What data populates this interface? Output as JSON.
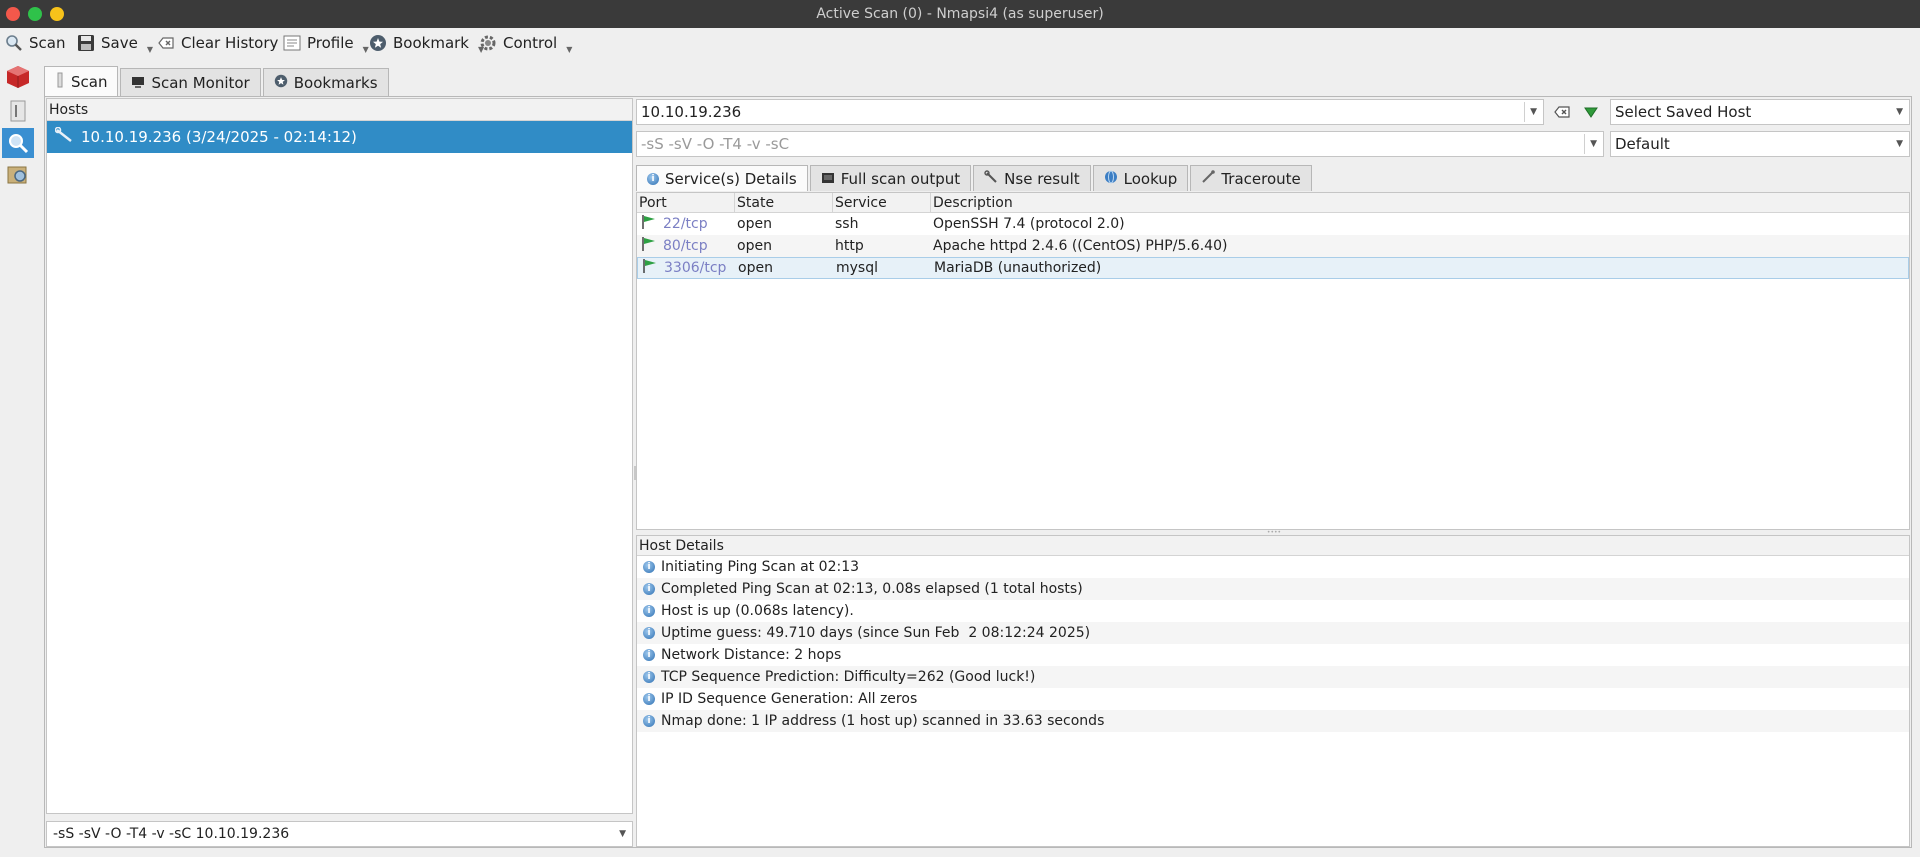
{
  "window": {
    "title": "Active Scan (0) - Nmapsi4 (as superuser)"
  },
  "toolbar": {
    "scan": "Scan",
    "save": "Save",
    "clear_history": "Clear History",
    "profile": "Profile",
    "bookmark": "Bookmark",
    "control": "Control"
  },
  "main_tabs": [
    "Scan",
    "Scan Monitor",
    "Bookmarks"
  ],
  "hosts": {
    "header": "Hosts",
    "items": [
      "10.10.19.236 (3/24/2025 - 02:14:12)"
    ],
    "command": "-sS -sV -O -T4 -v -sC 10.10.19.236"
  },
  "target": {
    "value": "10.10.19.236",
    "saved_host": "Select Saved Host",
    "options": "-sS -sV -O -T4 -v -sC",
    "profile": "Default"
  },
  "result_tabs": [
    "Service(s) Details",
    "Full scan output",
    "Nse result",
    "Lookup",
    "Traceroute"
  ],
  "ports": {
    "columns": [
      "Port",
      "State",
      "Service",
      "Description"
    ],
    "rows": [
      {
        "port": "22/tcp",
        "state": "open",
        "service": "ssh",
        "description": "OpenSSH 7.4 (protocol 2.0)"
      },
      {
        "port": "80/tcp",
        "state": "open",
        "service": "http",
        "description": "Apache httpd 2.4.6 ((CentOS) PHP/5.6.40)"
      },
      {
        "port": "3306/tcp",
        "state": "open",
        "service": "mysql",
        "description": "MariaDB (unauthorized)"
      }
    ]
  },
  "host_details": {
    "header": "Host Details",
    "lines": [
      "Initiating Ping Scan at 02:13",
      "Completed Ping Scan at 02:13, 0.08s elapsed (1 total hosts)",
      "Host is up (0.068s latency).",
      "Uptime guess: 49.710 days (since Sun Feb  2 08:12:24 2025)",
      "Network Distance: 2 hops",
      "TCP Sequence Prediction: Difficulty=262 (Good luck!)",
      "IP ID Sequence Generation: All zeros",
      "Nmap done: 1 IP address (1 host up) scanned in 33.63 seconds"
    ]
  },
  "colors": {
    "selection": "#308cc6",
    "port_link": "#7b7fc4",
    "titlebar": "#3a3a3a"
  }
}
